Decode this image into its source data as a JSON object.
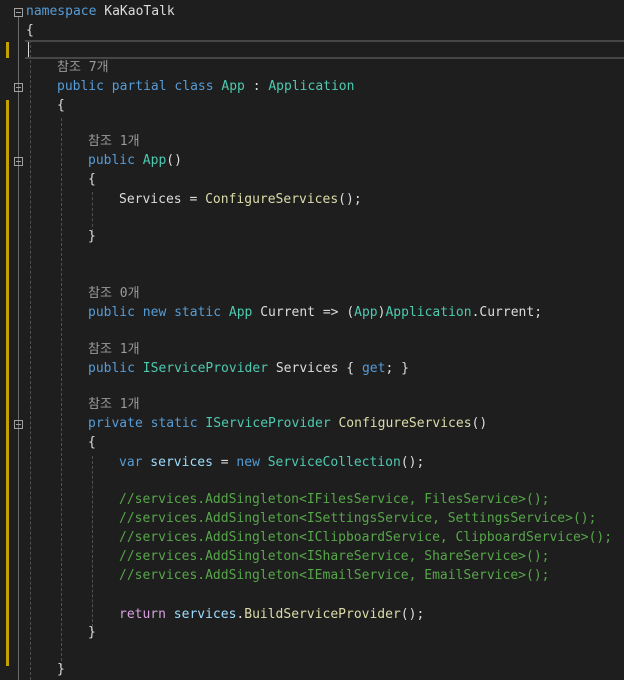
{
  "editor": {
    "lines": {
      "l1_namespace_kw": "namespace",
      "l1_namespace_name": " KaKaoTalk",
      "l2_brace": "{",
      "l4_ref": "참조 7개",
      "l5_public": "public",
      "l5_partial": " partial",
      "l5_class": " class",
      "l5_app": " App",
      "l5_colon": " : ",
      "l5_application": "Application",
      "l6_brace": "{",
      "l8_ref": "참조 1개",
      "l9_public": "public",
      "l9_app": " App",
      "l9_parens": "()",
      "l10_brace": "{",
      "l11_services": "Services",
      "l11_eq": " = ",
      "l11_configure": "ConfigureServices",
      "l11_end": "();",
      "l13_brace": "}",
      "l16_ref": "참조 0개",
      "l17_public": "public",
      "l17_new": " new",
      "l17_static": " static",
      "l17_app": " App",
      "l17_current": " Current",
      "l17_arrow": " => (",
      "l17_app2": "App",
      "l17_close": ")",
      "l17_application": "Application",
      "l17_dot": ".",
      "l17_current2": "Current",
      "l17_semi": ";",
      "l19_ref": "참조 1개",
      "l20_public": "public",
      "l20_isp": " IServiceProvider",
      "l20_services": " Services",
      "l20_open": " { ",
      "l20_get": "get",
      "l20_close": "; }",
      "l22_ref": "참조 1개",
      "l23_private": "private",
      "l23_static": " static",
      "l23_isp": " IServiceProvider",
      "l23_configure": " ConfigureServices",
      "l23_parens": "()",
      "l24_brace": "{",
      "l25_var": "var",
      "l25_services": " services",
      "l25_eq": " = ",
      "l25_new": "new",
      "l25_sc": " ServiceCollection",
      "l25_end": "();",
      "l27_comment": "//services.AddSingleton<IFilesService, FilesService>();",
      "l28_comment": "//services.AddSingleton<ISettingsService, SettingsService>();",
      "l29_comment": "//services.AddSingleton<IClipboardService, ClipboardService>();",
      "l30_comment": "//services.AddSingleton<IShareService, ShareService>();",
      "l31_comment": "//services.AddSingleton<IEmailService, EmailService>();",
      "l33_return": "return",
      "l33_services": " services",
      "l33_dot": ".",
      "l33_build": "BuildServiceProvider",
      "l33_end": "();",
      "l34_brace": "}",
      "l36_brace": "}"
    }
  },
  "colors": {
    "background": "#1e1e1e",
    "keyword": "#569cd6",
    "type": "#4ec9b0",
    "method": "#dcdcaa",
    "comment": "#57a64a",
    "control": "#d8a0df",
    "modified_bar": "#c4a100"
  },
  "icons": [
    "fold-collapse-icon"
  ]
}
